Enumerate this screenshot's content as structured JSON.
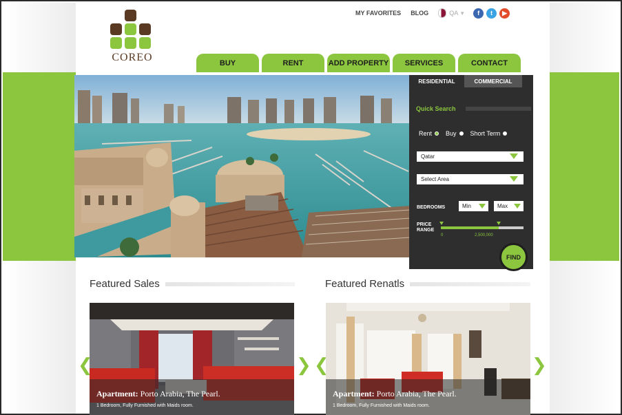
{
  "brand": {
    "name": "COREO"
  },
  "top_links": {
    "favorites": "MY FAVORITES",
    "blog": "BLOG",
    "language": "QA",
    "social": [
      "facebook-icon",
      "twitter-icon",
      "youtube-icon"
    ]
  },
  "nav": {
    "tabs": [
      {
        "label": "BUY"
      },
      {
        "label": "RENT"
      },
      {
        "label": "ADD PROPERTY"
      },
      {
        "label": "SERVICES"
      },
      {
        "label": "CONTACT"
      }
    ]
  },
  "search": {
    "tab_residential": "RESIDENTIAL",
    "tab_commercial": "COMMERCIAL",
    "quick_search": "Quick Search",
    "options": {
      "rent": "Rent",
      "buy": "Buy",
      "short_term": "Short Term"
    },
    "country": "Qatar",
    "area": "Select Area",
    "bedrooms_label": "BEDROOMS",
    "bed_min": "Min",
    "bed_max": "Max",
    "price_label_1": "PRICE",
    "price_label_2": "RANGE",
    "price_min": "0",
    "price_max": "2,500,000",
    "find": "FIND"
  },
  "featured": {
    "sales_title": "Featured Sales",
    "rentals_title": "Featured Renatls",
    "sales_card": {
      "type": "Apartment:",
      "location": "Porto Arabia, The Pearl.",
      "desc": "1 Bedroom, Fully Furnished with Maids room."
    },
    "rental_card": {
      "type": "Apartment:",
      "location": "Porto Arabia, The Pearl.",
      "desc": "1 Bedroom, Fully Furnished with Maids room."
    }
  },
  "colors": {
    "accent": "#8cc63f",
    "brand_brown": "#5a3a22",
    "panel": "#2e2e2e"
  }
}
